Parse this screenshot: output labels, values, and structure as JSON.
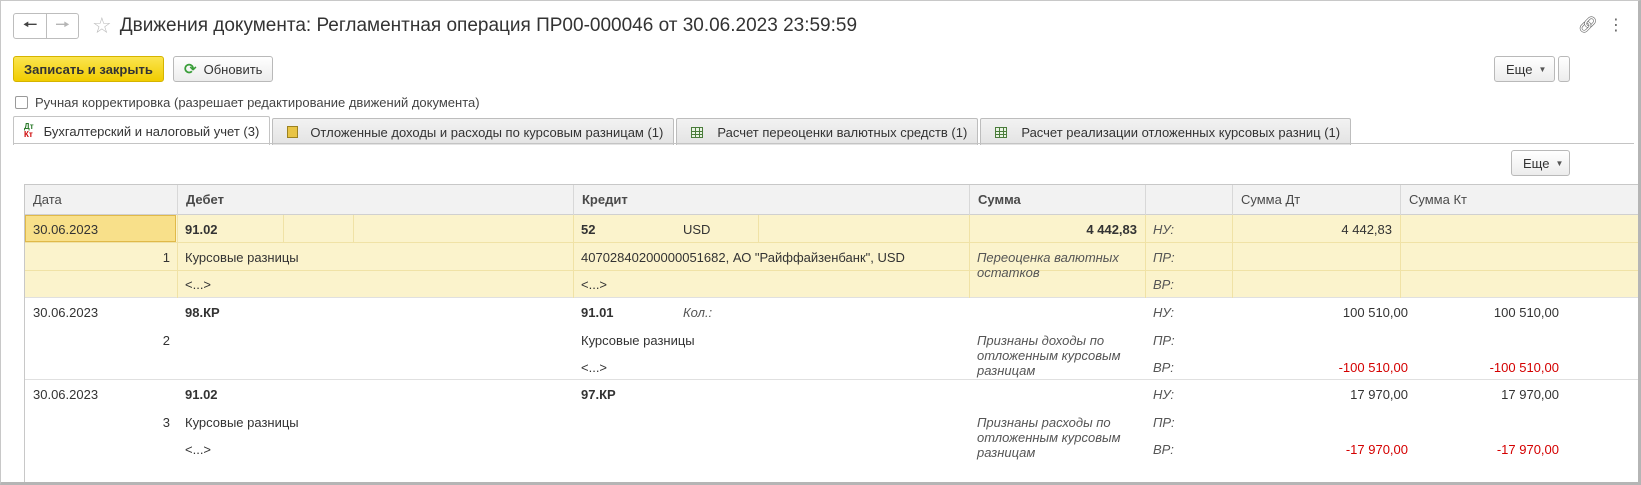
{
  "window": {
    "title": "Движения документа: Регламентная операция ПР00-000046 от 30.06.2023 23:59:59"
  },
  "toolbar": {
    "save_close": "Записать и закрыть",
    "refresh": "Обновить",
    "more": "Еще"
  },
  "manual_edit": {
    "label": "Ручная корректировка (разрешает редактирование движений документа)",
    "checked": false
  },
  "tabs": [
    {
      "label": "Бухгалтерский и налоговый учет (3)",
      "icon": "dt-kt-icon",
      "active": true
    },
    {
      "label": "Отложенные доходы и расходы по курсовым разницам (1)",
      "icon": "document-icon",
      "active": false
    },
    {
      "label": "Расчет переоценки валютных средств (1)",
      "icon": "grid-icon",
      "active": false
    },
    {
      "label": "Расчет реализации отложенных курсовых разниц (1)",
      "icon": "grid-icon",
      "active": false
    }
  ],
  "table_more": "Еще",
  "columns": [
    "Дата",
    "Дебет",
    "Кредит",
    "Сумма",
    "",
    "Сумма Дт",
    "Сумма Кт"
  ],
  "entries": [
    {
      "date": "30.06.2023",
      "num": "1",
      "debit_account": "91.02",
      "debit_sub1": "Курсовые разницы",
      "debit_sub2": "<...>",
      "credit_account": "52",
      "credit_currency": "USD",
      "credit_sub1": "40702840200000051682, АО \"Райффайзенбанк\", USD",
      "credit_sub2": "<...>",
      "amount": "4 442,83",
      "qty_label": "",
      "description": "Переоценка валютных остатков",
      "nu": "НУ:",
      "pr": "ПР:",
      "vr": "ВР:",
      "nu_dt": "4 442,83",
      "nu_kt": "",
      "vr_dt": "",
      "vr_kt": ""
    },
    {
      "date": "30.06.2023",
      "num": "2",
      "debit_account": "98.КР",
      "debit_sub1": "",
      "debit_sub2": "",
      "credit_account": "91.01",
      "credit_currency": "",
      "credit_sub1": "Курсовые разницы",
      "credit_sub2": "<...>",
      "amount": "",
      "qty_label": "Кол.:",
      "description": "Признаны доходы по отложенным курсовым разницам",
      "nu": "НУ:",
      "pr": "ПР:",
      "vr": "ВР:",
      "nu_dt": "100 510,00",
      "nu_kt": "100 510,00",
      "vr_dt": "-100 510,00",
      "vr_kt": "-100 510,00"
    },
    {
      "date": "30.06.2023",
      "num": "3",
      "debit_account": "91.02",
      "debit_sub1": "Курсовые разницы",
      "debit_sub2": "<...>",
      "credit_account": "97.КР",
      "credit_currency": "",
      "credit_sub1": "",
      "credit_sub2": "",
      "amount": "",
      "qty_label": "",
      "description": "Признаны расходы по отложенным курсовым разницам",
      "nu": "НУ:",
      "pr": "ПР:",
      "vr": "ВР:",
      "nu_dt": "17 970,00",
      "nu_kt": "17 970,00",
      "vr_dt": "-17 970,00",
      "vr_kt": "-17 970,00"
    }
  ]
}
